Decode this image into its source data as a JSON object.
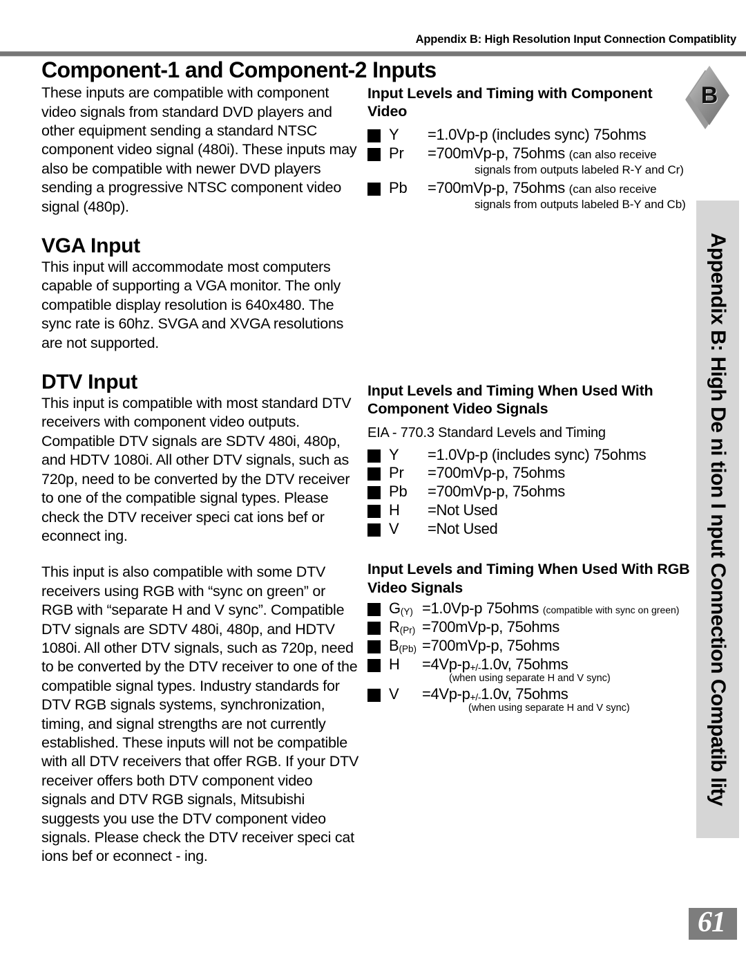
{
  "header": {
    "running_title": "Appendix B: High Resolution Input Connection Compatiblity"
  },
  "badge": {
    "letter": "B"
  },
  "side_tab": {
    "text": "Appendix B: High De ni tion I nput Connection Compatib lity"
  },
  "page_number": "61",
  "left_column": {
    "title": "Component-1 and Component-2 Inputs",
    "intro_paragraph": "These inputs are compatible with component video signals from standard DVD players and other equipment sending a standard NTSC component video signal (480i).  These inputs may also be compatible with newer DVD players sending a progressive NTSC component video signal (480p).",
    "vga": {
      "heading": "VGA Input",
      "paragraph": "This input will accommodate most computers capable of supporting a VGA monitor.  The only compatible display resolution is 640x480.  The sync rate is 60hz.  SVGA and XVGA resolutions are not supported."
    },
    "dtv": {
      "heading": "DTV Input",
      "paragraph_1": "This input is compatible with most standard DTV receivers with component video outputs.  Compatible DTV signals are SDTV 480i, 480p, and HDTV 1080i.  All other DTV signals, such as 720p, need to be converted by the DTV receiver to one of the compatible signal types.  Please check the DTV receiver speci cat ions bef or econnect ing.",
      "paragraph_2": "This input is also compatible with some DTV receivers using RGB with “sync on green” or RGB with “separate H and V sync”.  Compatible DTV signals are SDTV 480i, 480p, and HDTV 1080i.  All other DTV signals, such as 720p, need to be converted by the DTV receiver to one of the compatible signal types.  Industry standards for DTV RGB signals systems, synchronization, timing, and signal strengths are not currently established.  These inputs will not be compatible with all DTV receivers that offer RGB.  If your DTV receiver offers both DTV component video signals and DTV RGB signals, Mitsubishi suggests you use the DTV component video signals.  Please check the DTV receiver speci cat ions bef or econnect - ing."
    }
  },
  "right_column": {
    "section_component": {
      "heading": "Input Levels and Timing with Component Video",
      "items": [
        {
          "symbol": "Y",
          "value": "=1.0Vp-p (includes sync) 75ohms",
          "paren": "",
          "continuation": ""
        },
        {
          "symbol": "Pr",
          "value": "=700mVp-p, 75ohms",
          "paren": "(can also receive",
          "continuation": "signals from outputs labeled R-Y and Cr)"
        },
        {
          "symbol": "Pb",
          "value": "=700mVp-p, 75ohms",
          "paren": "(can also receive",
          "continuation": "signals from outputs labeled B-Y and Cb)"
        }
      ]
    },
    "section_component_timing": {
      "heading": "Input Levels and Timing When Used With Component Video Signals",
      "standard_line": "EIA - 770.3 Standard Levels and Timing",
      "items": [
        {
          "symbol": "Y",
          "value": "=1.0Vp-p (includes sync) 75ohms"
        },
        {
          "symbol": "Pr",
          "value": "=700mVp-p, 75ohms"
        },
        {
          "symbol": "Pb",
          "value": "=700mVp-p,  75ohms"
        },
        {
          "symbol": "H",
          "value": "=Not Used"
        },
        {
          "symbol": "V",
          "value": "=Not Used"
        }
      ]
    },
    "section_rgb": {
      "heading": "Input Levels and Timing When Used With RGB Video Signals",
      "items": [
        {
          "symbol": "G",
          "subscript": "(Y)",
          "value": "=1.0Vp-p 75ohms",
          "tiny_note": "(compatible with sync on green)",
          "below_note": ""
        },
        {
          "symbol": "R",
          "subscript": "(Pr)",
          "value": "=700mVp-p, 75ohms",
          "tiny_note": "",
          "below_note": ""
        },
        {
          "symbol": "B",
          "subscript": "(Pb)",
          "value": "=700mVp-p,  75ohms",
          "tiny_note": "",
          "below_note": ""
        },
        {
          "symbol": "H",
          "subscript": "",
          "value": "=4Vp-p",
          "suffix_pm": "+/-",
          "suffix_value": "1.0v, 75ohms",
          "tiny_note": "",
          "below_note": "(when using separate H and V sync)"
        },
        {
          "symbol": "V",
          "subscript": "",
          "value": "=4Vp-p",
          "suffix_pm": "+/-",
          "suffix_value": "1.0v, 75ohms",
          "tiny_note": "",
          "below_note": "(when using separate H and V sync)"
        }
      ]
    }
  }
}
